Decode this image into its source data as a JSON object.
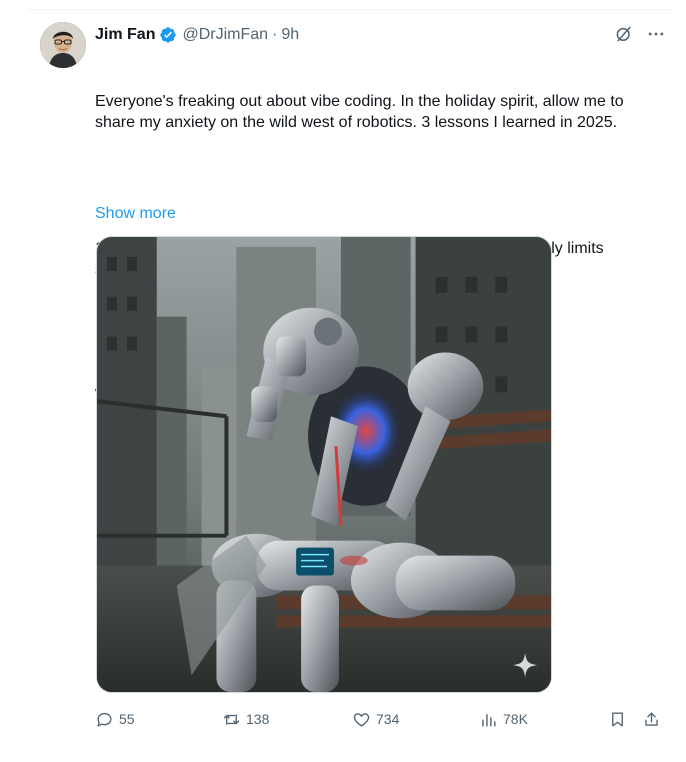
{
  "author": {
    "name": "Jim Fan",
    "handle": "@DrJimFan",
    "separator": "·",
    "time": "9h",
    "verified": true
  },
  "tweet": {
    "paragraphs": [
      "Everyone's freaking out about vibe coding. In the holiday spirit, allow me to share my anxiety on the wild west of robotics. 3 lessons I learned in 2025.",
      "1. Hardware is ahead of software, but hardware reliability severely limits software iteration speed.",
      "We've seen exquisite"
    ],
    "show_more": "Show more"
  },
  "media": {
    "icon": "sparkle-icon"
  },
  "actions": {
    "replies": "55",
    "reposts": "138",
    "likes": "734",
    "views": "78K"
  },
  "colors": {
    "accent": "#1d9bf0",
    "muted": "#536471",
    "text": "#0f1419"
  }
}
